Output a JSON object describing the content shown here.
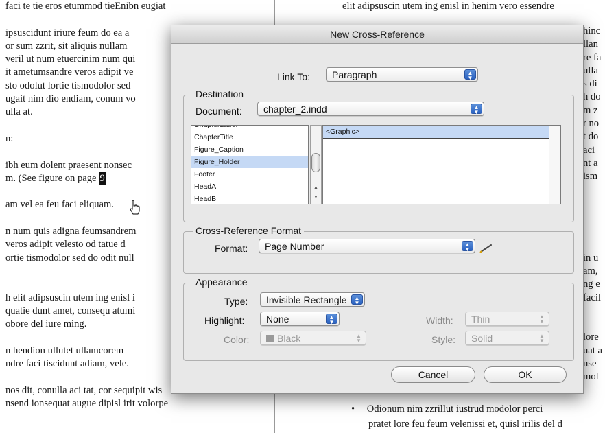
{
  "document": {
    "left_lines": [
      "faci te tie eros etummod tieEnibn eugiat",
      "",
      "ipsuscidunt iriure feum do ea a",
      "or sum zzrit, sit aliquis nullam",
      "veril ut num etuercinim num qui",
      "it ametumsandre veros adipit ve",
      "sto odolut lortie tismodolor sed",
      "ugait nim dio endiam, conum vo",
      "ulla at.",
      "",
      "n:",
      "",
      "ibh eum dolent praesent nonsec",
      "m. (See figure on page",
      "",
      "am vel ea feu faci eliquam.",
      "",
      "n num quis adigna feumsandrem",
      "veros adipit velesto od tatue d",
      "ortie tismodolor sed do odit null",
      "",
      "",
      "h elit adipsuscin utem ing enisl i",
      "quatie dunt amet, consequ atumi",
      "obore del iure ming.",
      "",
      "n hendion ullutet ullamcorem",
      "ndre faci tiscidunt adiam, vele.",
      "",
      "nos dit, conulla aci tat, cor sequipit wis",
      "nsend ionsequat augue dipisl irit volorpe"
    ],
    "figure_marker": "9",
    "right_lines": [
      "elit adipsuscin utem ing enisl in henim vero essendre",
      "",
      "",
      "",
      "",
      "",
      "",
      "",
      "",
      "",
      "",
      "",
      "",
      "",
      "",
      "",
      "",
      "",
      "",
      "in u",
      "am,",
      "ng e",
      "facil",
      "",
      "",
      "lore",
      "uat a",
      "nse",
      "mol"
    ],
    "right_edge_lines": [
      "hinc",
      "llan",
      "re fa",
      "ulla",
      "s di",
      "h do",
      "m z",
      "r no",
      "t do",
      "aci",
      "nt a",
      "ism"
    ],
    "bullet_text": "Odionum nim zzrillut iustrud modolor perci",
    "bullet_text2": "pratet lore feu feum velenissi et, quisl irilis del d"
  },
  "dialog": {
    "title": "New Cross-Reference",
    "link_to_label": "Link To:",
    "link_to_value": "Paragraph",
    "destination": {
      "title": "Destination",
      "document_label": "Document:",
      "document_value": "chapter_2.indd",
      "styles": [
        "ChapterLabel",
        "ChapterTitle",
        "Figure_Caption",
        "Figure_Holder",
        "Footer",
        "HeadA",
        "HeadB"
      ],
      "selected_style": "Figure_Holder",
      "paragraphs": [
        "<Graphic>"
      ]
    },
    "format_group": {
      "title": "Cross-Reference Format",
      "format_label": "Format:",
      "format_value": "Page Number"
    },
    "appearance": {
      "title": "Appearance",
      "type_label": "Type:",
      "type_value": "Invisible Rectangle",
      "highlight_label": "Highlight:",
      "highlight_value": "None",
      "color_label": "Color:",
      "color_value": "Black",
      "width_label": "Width:",
      "width_value": "Thin",
      "style_label": "Style:",
      "style_value": "Solid"
    },
    "cancel_label": "Cancel",
    "ok_label": "OK"
  },
  "colors": {
    "frame_purple": "#8e44ad",
    "selection": "#c5d9f5",
    "aqua_blue": "#2b62c1"
  }
}
